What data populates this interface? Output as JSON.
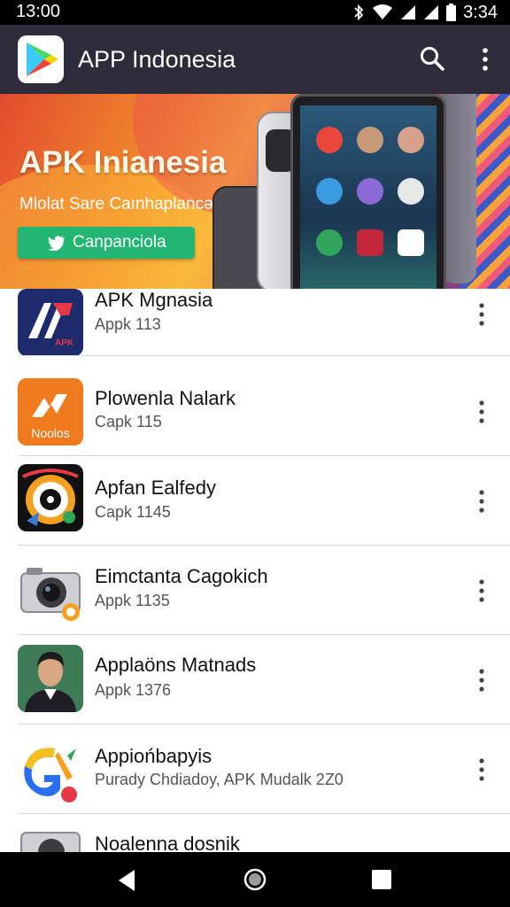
{
  "status_bar": {
    "time_left": "13:00",
    "time_right": "3:34",
    "icons": [
      "bluetooth-icon",
      "wifi-icon",
      "signal-icon",
      "signal-icon",
      "battery-icon"
    ]
  },
  "app_bar": {
    "title": "APP Indonesia",
    "logo": "play-store-logo",
    "actions": [
      "search-icon",
      "overflow-menu-icon"
    ]
  },
  "banner": {
    "title": "APK Inianesia",
    "subtitle": "Mlolat Sare Caınhaplancə",
    "cta_label": "Canpanciola",
    "cta_icon": "twitter-bird-icon"
  },
  "apps": [
    {
      "name": "APK Mgnasia",
      "sub": "Appk 113",
      "icon": "apk-logo-icon"
    },
    {
      "name": "Plowenla Nalark",
      "sub": "Capk 115",
      "icon": "noolos-logo-icon",
      "icon_text": "Noolos"
    },
    {
      "name": "Apfan Ealfedy",
      "sub": "Capk 1145",
      "icon": "vinyl-badge-icon"
    },
    {
      "name": "Eimctanta Cagokich",
      "sub": "Appk 1135",
      "icon": "camera-icon"
    },
    {
      "name": "Applaöns Matnads",
      "sub": "Appk 1376",
      "icon": "profile-photo-icon"
    },
    {
      "name": "Appiońbapyis",
      "sub": "Purady Chdiadoy, APK Mudalk 2Z0",
      "icon": "colorful-g-logo-icon"
    },
    {
      "name": "Noalenna dosnik",
      "sub": "",
      "icon": "camera-icon"
    }
  ],
  "nav_bar": {
    "icons": [
      "back-icon",
      "home-icon",
      "recents-icon"
    ]
  },
  "colors": {
    "app_bar_bg": "#2e2b3a",
    "cta_green": "#22b573",
    "noolos_orange": "#f07a1e",
    "apk_navy": "#1d2a6b"
  }
}
